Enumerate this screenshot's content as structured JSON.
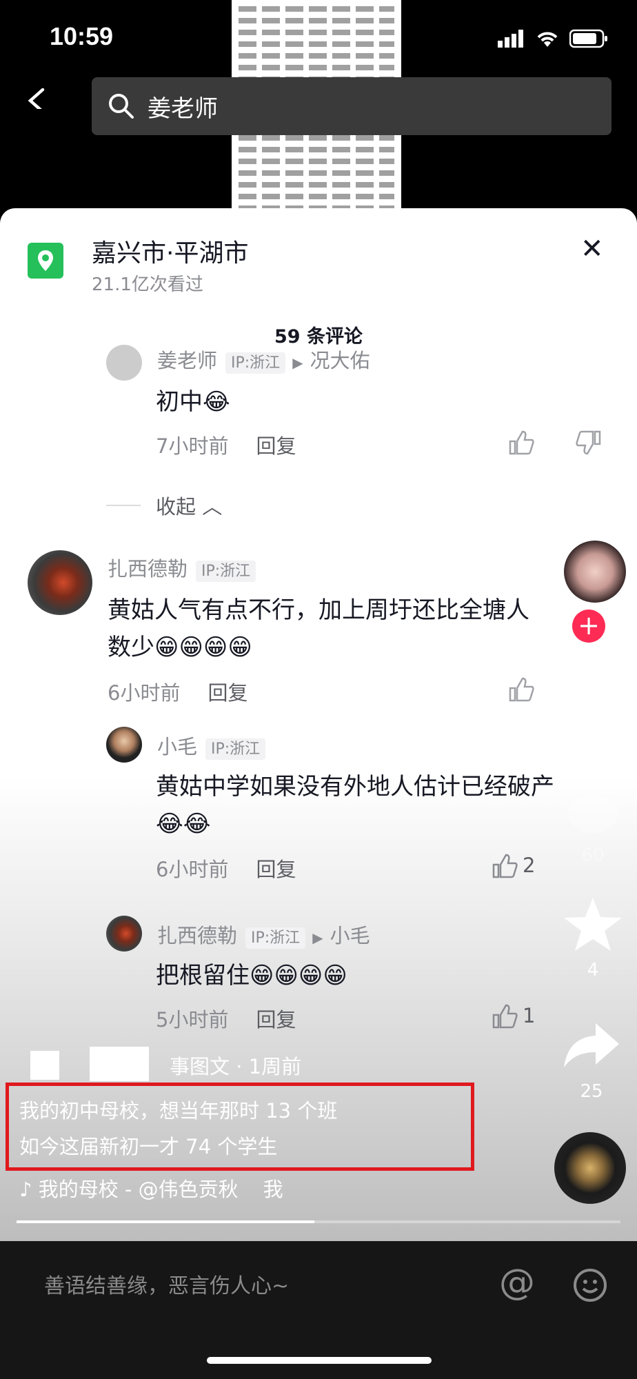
{
  "status": {
    "time": "10:59"
  },
  "search": {
    "query": "姜老师"
  },
  "location": {
    "title": "嘉兴市·平湖市",
    "views": "21.1亿次看过"
  },
  "comments_count": "59 条评论",
  "comments": {
    "c0": {
      "user": "姜老师",
      "ip": "IP:浙江",
      "reply_to": "况大佑",
      "text": "初中",
      "time": "7小时前",
      "reply": "回复"
    },
    "collapse": "收起",
    "c1": {
      "user": "扎西德勒",
      "ip": "IP:浙江",
      "text_line1": "黄姑人气有点不行，加上周圩还比全塘人",
      "text_line2": "数少",
      "time": "6小时前",
      "reply": "回复"
    },
    "c2": {
      "user": "小毛",
      "ip": "IP:浙江",
      "text": "黄姑中学如果没有外地人估计已经破产",
      "time": "6小时前",
      "reply": "回复",
      "likes": "2"
    },
    "c3": {
      "user": "扎西德勒",
      "ip": "IP:浙江",
      "reply_to": "小毛",
      "text": "把根留住",
      "time": "5小时前",
      "reply": "回复",
      "likes": "1"
    },
    "c4": {
      "meta": "事图文 · 1周前"
    }
  },
  "rail": {
    "likes": "32",
    "comments": "60",
    "favorites": "4",
    "shares": "25"
  },
  "caption": {
    "line1": "我的初中母校，想当年那时 13 个班",
    "line2": "如今这届新初一才 74 个学生",
    "music": "我的母校 - @伟色贡秋",
    "music_extra": "我"
  },
  "input": {
    "placeholder": "善语结善缘，恶言伤人心~"
  }
}
